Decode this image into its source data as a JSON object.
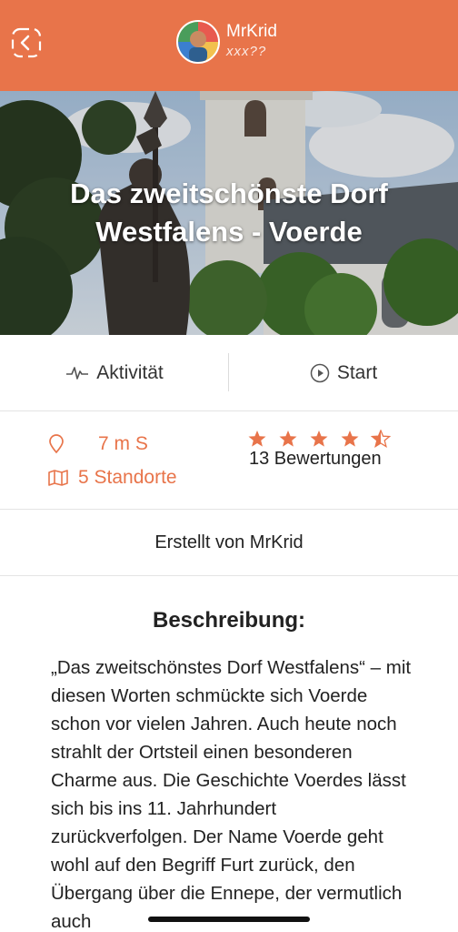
{
  "header": {
    "user_name": "MrKrid",
    "user_subtitle": "xxx??",
    "accent_color": "#e8744a",
    "back_icon": "chevron-left-icon"
  },
  "hero": {
    "title": "Das zweitschönste Dorf Westfalens - Voerde"
  },
  "actions": {
    "activity_label": "Aktivität",
    "activity_icon": "pulse-icon",
    "start_label": "Start",
    "start_icon": "play-circle-icon"
  },
  "stats": {
    "distance": "7 m S",
    "distance_icon": "location-pin-icon",
    "locations": "5 Standorte",
    "locations_icon": "map-icon",
    "rating": 4.5,
    "rating_max": 5,
    "reviews": "13 Bewertungen"
  },
  "creator": {
    "text": "Erstellt von MrKrid"
  },
  "description": {
    "heading": "Beschreibung:",
    "body": "„Das zweitschönstes Dorf Westfalens“ – mit diesen Worten schmückte sich Voerde schon vor vielen Jahren. Auch heute noch strahlt der Ortsteil einen besonderen Charme aus. Die Geschichte Voerdes lässt sich bis ins 11. Jahrhundert zurückverfolgen. Der Name Voerde geht wohl auf den Begriff Furt zurück, den Übergang über die Ennepe, der vermutlich auch"
  }
}
